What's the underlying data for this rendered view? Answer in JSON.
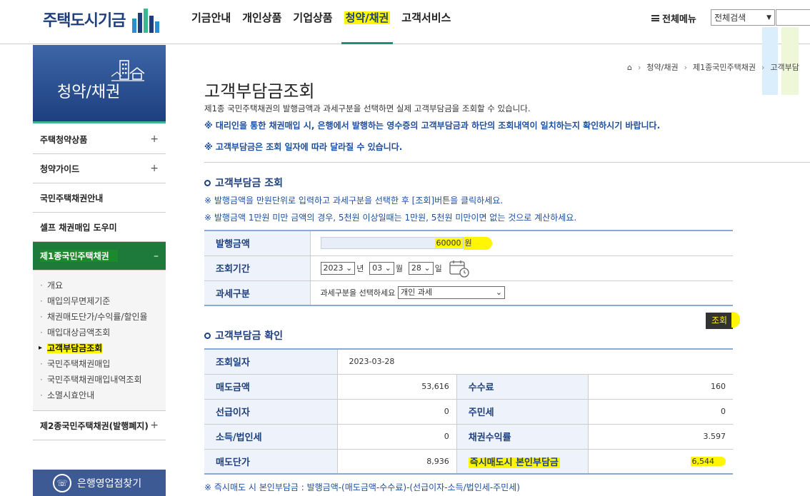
{
  "header": {
    "logo_text": "주택도시기금",
    "nav": [
      {
        "label": "기금안내"
      },
      {
        "label": "개인상품"
      },
      {
        "label": "기업상품"
      },
      {
        "label": "청약/채권"
      },
      {
        "label": "고객서비스"
      }
    ],
    "menu_all": "전체메뉴",
    "search_select": "전체검색"
  },
  "sidebar": {
    "banner_title": "청약/채권",
    "items": [
      {
        "label": "주택청약상품",
        "toggle": "+"
      },
      {
        "label": "청약가이드",
        "toggle": "+"
      },
      {
        "label": "국민주택채권안내"
      },
      {
        "label": "셀프 채권매입 도우미"
      },
      {
        "label": "제1종국민주택채권",
        "toggle": "–"
      }
    ],
    "sub_items": [
      "개요",
      "매입의무면제기준",
      "채권매도단가/수익률/할인율",
      "매입대상금액조회",
      "고객부담금조회",
      "국민주택채권매입",
      "국민주택채권매입내역조회",
      "소멸시효안내"
    ],
    "item_last": {
      "label": "제2종국민주택채권(발행폐지)",
      "toggle": "+"
    },
    "branch_button": "은행영업점찾기"
  },
  "breadcrumb": [
    "청약/채권",
    "제1종국민주택채권",
    "고객부담"
  ],
  "page": {
    "title": "고객부담금조회",
    "desc": "제1종 국민주택채권의 발행금액과 과세구분을 선택하면 실제 고객부담금을 조회할 수 있습니다.",
    "notice1": "※ 대리인을 통한 채권매입 시, 은행에서 발행하는 영수증의 고객부담금과 하단의 조회내역이 일치하는지 확인하시기 바랍니다.",
    "notice2": "※ 고객부담금은 조회 일자에 따라 달라질 수 있습니다."
  },
  "query": {
    "section_title": "고객부담금 조회",
    "guide1": "※ 발행금액을 만원단위로 입력하고 과세구분을 선택한 후 [조회]버튼을 클릭하세요.",
    "guide2": "※ 발행금액 1만원 미만 금액의 경우, 5천원 이상일때는 1만원, 5천원 미만이면 없는 것으로 계산하세요.",
    "amount_label": "발행금액",
    "amount_value": "60000",
    "amount_unit": "원",
    "period_label": "조회기간",
    "year": "2023",
    "year_unit": "년",
    "month": "03",
    "month_unit": "월",
    "day": "28",
    "day_unit": "일",
    "tax_label": "과세구분",
    "tax_prompt": "과세구분을 선택하세요",
    "tax_value": "개인 과세",
    "search_button": "조회"
  },
  "result": {
    "section_title": "고객부담금 확인",
    "date_label": "조회일자",
    "date_value": "2023-03-28",
    "rows": [
      {
        "l1": "매도금액",
        "v1": "53,616",
        "l2": "수수료",
        "v2": "160"
      },
      {
        "l1": "선급이자",
        "v1": "0",
        "l2": "주민세",
        "v2": "0"
      },
      {
        "l1": "소득/법인세",
        "v1": "0",
        "l2": "채권수익률",
        "v2": "3.597"
      },
      {
        "l1": "매도단가",
        "v1": "8,936",
        "l2": "즉시매도시 본인부담금",
        "v2": "6,544"
      }
    ],
    "formula": "※ 즉시매도 시 본인부담금 : 발행금액-(매도금액-수수료)-(선급이자-소득/법인세-주민세)"
  },
  "colors": {
    "brand_navy": "#1d3f7e",
    "accent_green": "#1e7a3a",
    "highlight": "#fff600"
  }
}
